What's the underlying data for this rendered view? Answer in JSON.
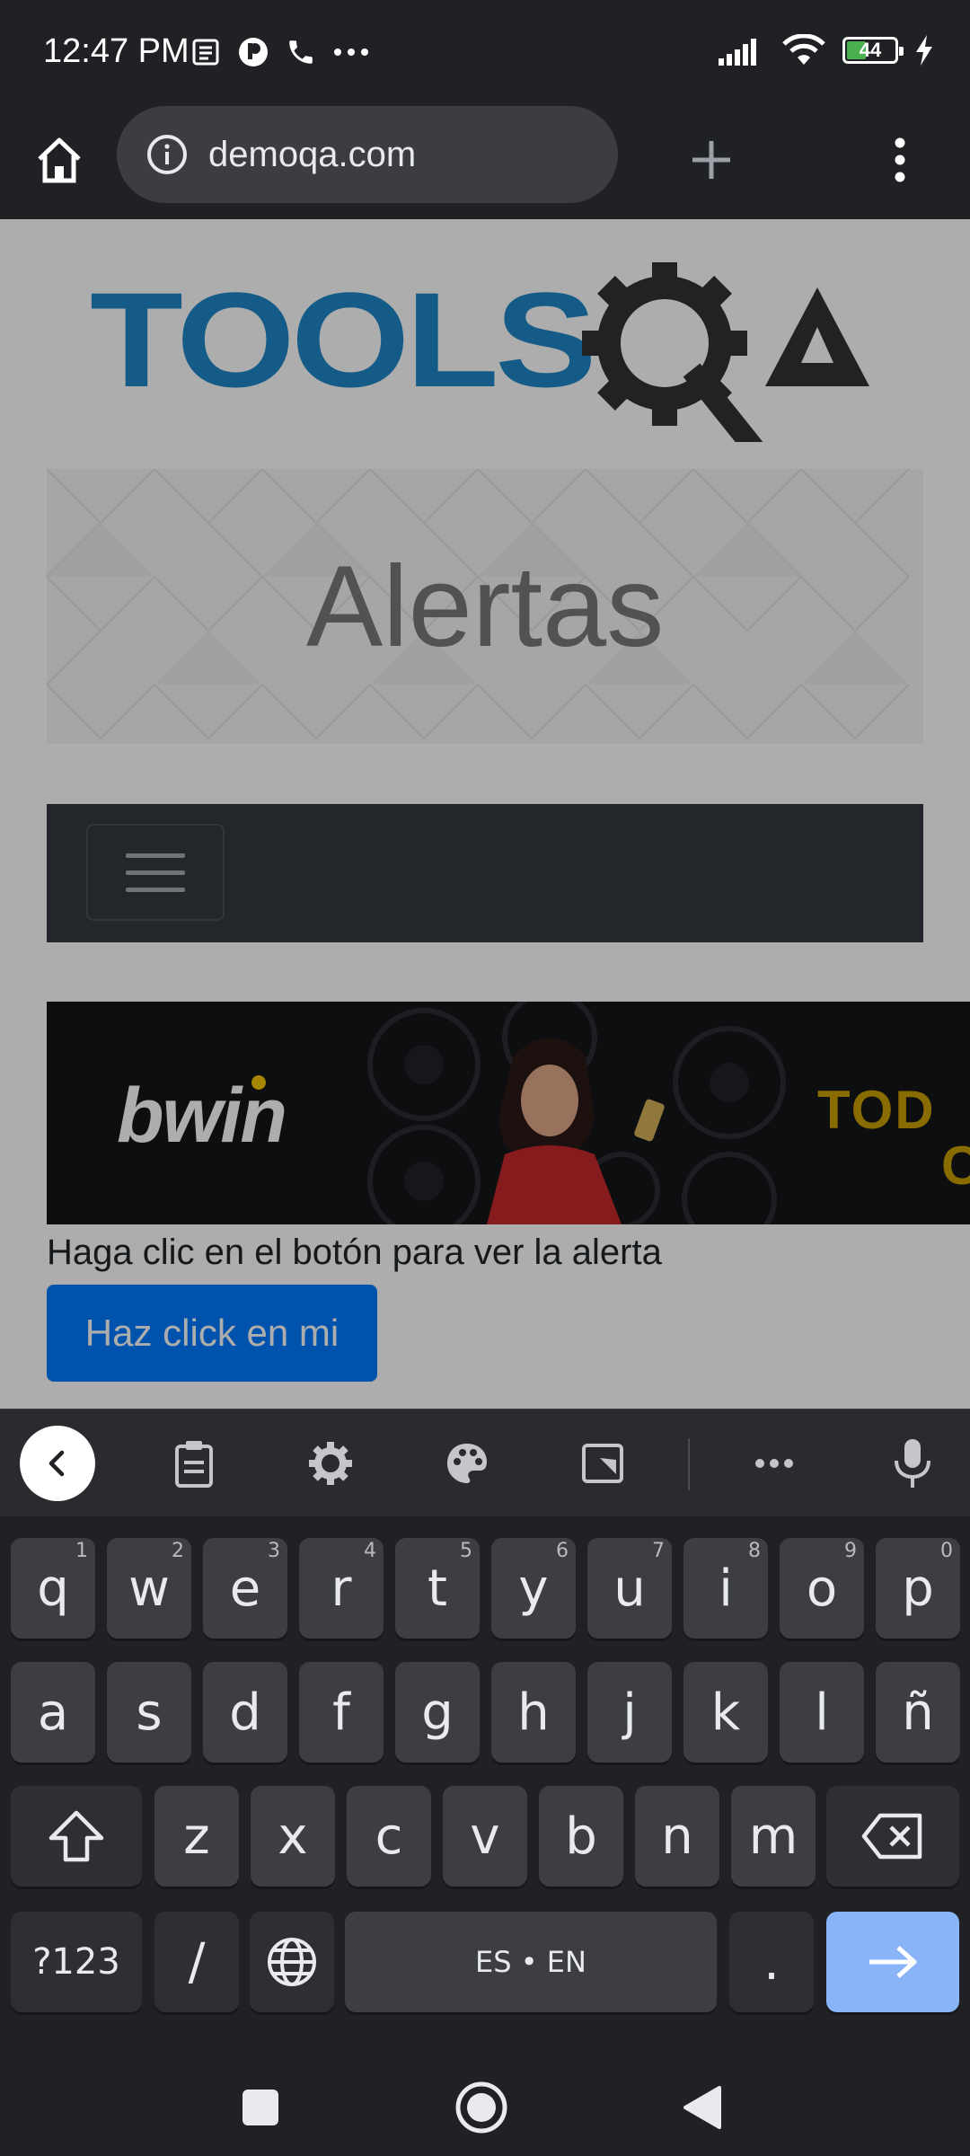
{
  "status_bar": {
    "time": "12:47 PM",
    "battery_level": "44",
    "battery_percent": 44,
    "notification_icons": [
      "news-icon",
      "app-icon",
      "phone-icon",
      "more-dots-icon"
    ]
  },
  "browser": {
    "url": "demoqa.com",
    "page_load_progress": 0.05
  },
  "page": {
    "logo_alt": "TOOLSQA",
    "banner_title": "Alertas",
    "ad": {
      "brand": "bwin",
      "side_text_1": "TOD",
      "side_text_2": "C"
    },
    "alert_description": "Haga clic en el botón para ver la alerta",
    "alert_button": "Haz click en mi"
  },
  "keyboard": {
    "row1": [
      {
        "k": "q",
        "h": "1"
      },
      {
        "k": "w",
        "h": "2"
      },
      {
        "k": "e",
        "h": "3"
      },
      {
        "k": "r",
        "h": "4"
      },
      {
        "k": "t",
        "h": "5"
      },
      {
        "k": "y",
        "h": "6"
      },
      {
        "k": "u",
        "h": "7"
      },
      {
        "k": "i",
        "h": "8"
      },
      {
        "k": "o",
        "h": "9"
      },
      {
        "k": "p",
        "h": "0"
      }
    ],
    "row2": [
      "a",
      "s",
      "d",
      "f",
      "g",
      "h",
      "j",
      "k",
      "l",
      "ñ"
    ],
    "row3": [
      "z",
      "x",
      "c",
      "v",
      "b",
      "n",
      "m"
    ],
    "symbols_key": "?123",
    "slash_key": "/",
    "space_label": "ES • EN",
    "period_key": ".",
    "colors": {
      "action_key": "#8ab4f8",
      "key": "#3c3e43"
    }
  },
  "colors": {
    "brand_blue": "#007bff",
    "toolsqa_blue": "#1e88c7",
    "navbar": "#343a40"
  }
}
